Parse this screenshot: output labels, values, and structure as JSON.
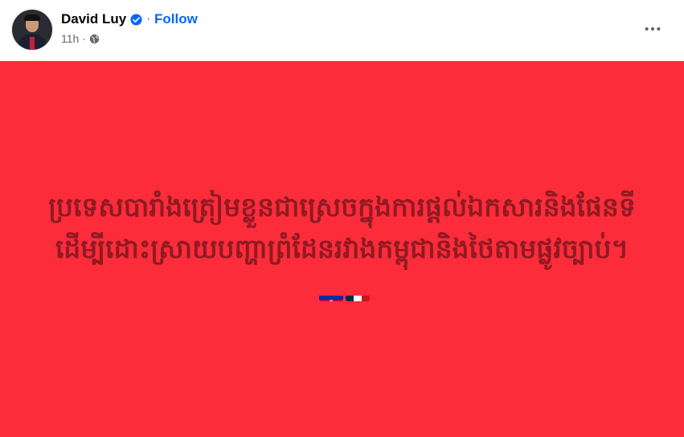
{
  "author": {
    "name": "David Luy",
    "verified_icon": "verified-check-icon",
    "follow_label": "Follow",
    "separator": "·"
  },
  "meta": {
    "time": "11h",
    "dot": "·",
    "audience_icon": "globe-icon"
  },
  "actions": {
    "more_icon": "more-options-icon"
  },
  "post": {
    "background_color": "#fd2c3b",
    "text_color": "#8f1a23",
    "text": "ប្រទេសបារាំងត្រៀមខ្លួនជាស្រេចក្នុងការផ្តល់ឯកសារនិងផែនទីដើម្បីដោះស្រាយបញ្ហាព្រំដែនរវាងកម្ពុជានិងថៃតាមផ្លូវច្បាប់។",
    "flags": [
      "cambodia-flag-icon",
      "france-flag-icon"
    ]
  },
  "colors": {
    "accent": "#0866ff",
    "secondary_text": "#65676b"
  }
}
